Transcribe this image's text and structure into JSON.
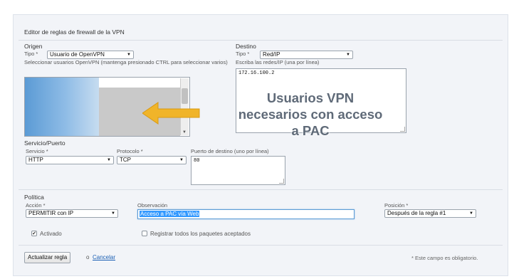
{
  "title": "Editor de reglas de firewall de la VPN",
  "origen": {
    "heading": "Origen",
    "tipo_label": "Tipo *",
    "tipo_value": "Usuario de OpenVPN",
    "help": "Seleccionar usuarios OpenVPN (mantenga presionado CTRL para seleccionar varios)"
  },
  "destino": {
    "heading": "Destino",
    "tipo_label": "Tipo *",
    "tipo_value": "Red/IP",
    "help": "Escriba las redes/IP (una por línea)",
    "value": "172.16.100.2"
  },
  "overlay": {
    "line1": "Usuarios VPN",
    "line2": "necesarios con acceso",
    "line3": "a PAC"
  },
  "servicio": {
    "heading": "Servicio/Puerto",
    "servicio_label": "Servicio *",
    "servicio_value": "HTTP",
    "protocolo_label": "Protocolo *",
    "protocolo_value": "TCP",
    "puerto_label": "Puerto de destino (uno por línea)",
    "puerto_value": "80"
  },
  "politica": {
    "heading": "Política",
    "accion_label": "Acción *",
    "accion_value": "PERMITIR con IP",
    "observacion_label": "Observación",
    "observacion_value": "Acceso a PAC vía Web",
    "posicion_label": "Posición *",
    "posicion_value": "Después de la regla #1"
  },
  "options": {
    "activado_label": "Activado",
    "activado_checked": true,
    "registrar_label": "Registrar todos los paquetes aceptados",
    "registrar_checked": false
  },
  "footer": {
    "update_button": "Actualizar regla",
    "or_text": "o",
    "cancel_link": "Cancelar",
    "required_note": "* Este campo es obligatorio."
  },
  "colors": {
    "accent_arrow": "#f0b429",
    "link": "#1a5fb4",
    "selection": "#5b9bd5"
  }
}
